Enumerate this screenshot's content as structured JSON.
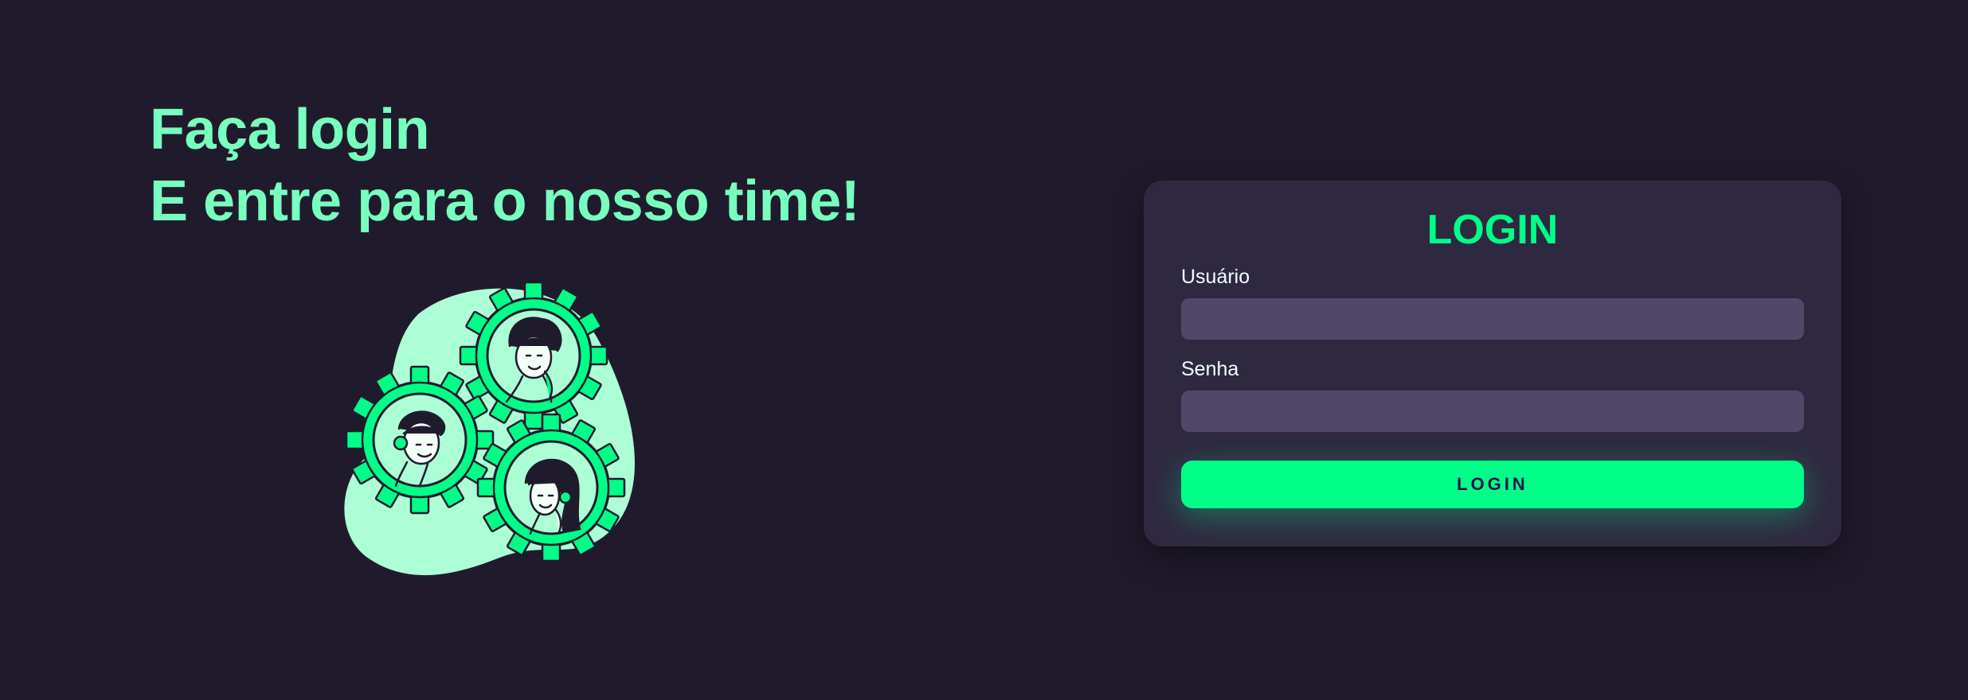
{
  "hero": {
    "line1": "Faça login",
    "line2": "E entre para o nosso time!"
  },
  "illustration": {
    "icon": "team-gears-illustration",
    "colors": {
      "blob": "#acfed6",
      "gear": "#00ff88",
      "outline": "#201b2c"
    }
  },
  "form": {
    "title": "LOGIN",
    "username_label": "Usuário",
    "username_value": "",
    "password_label": "Senha",
    "password_value": "",
    "button_label": "LOGIN"
  },
  "colors": {
    "background": "#201b2c",
    "card": "#2f2841",
    "input": "#514869",
    "accent": "#00ff88",
    "heading": "#77ffc0"
  }
}
